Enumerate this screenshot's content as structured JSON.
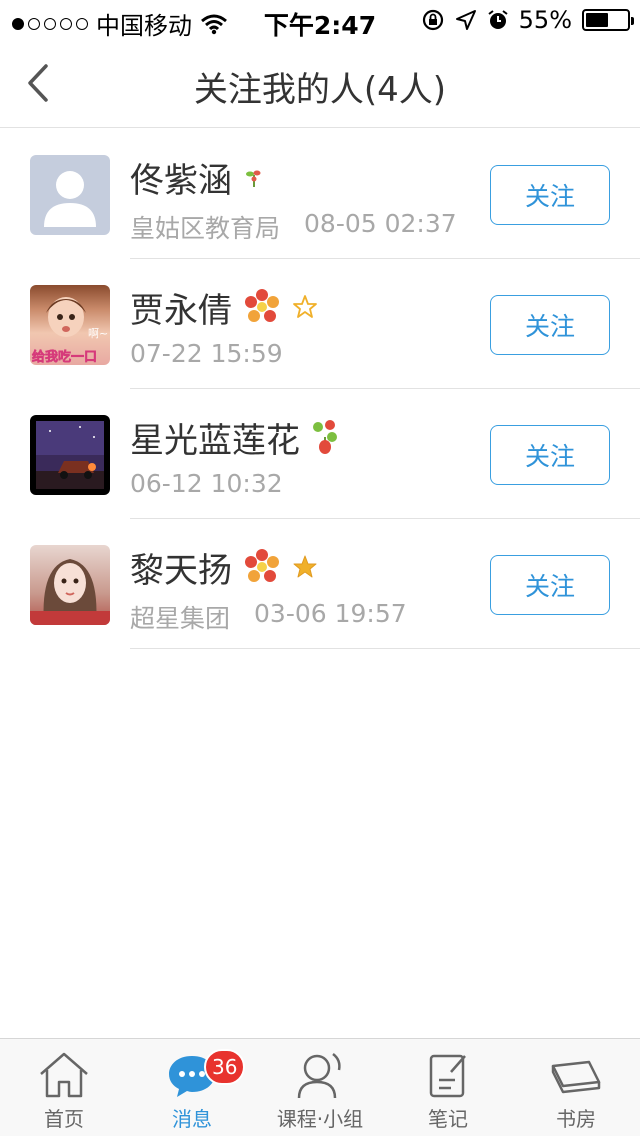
{
  "status_bar": {
    "carrier": "中国移动",
    "time": "下午2:47",
    "battery": "55%",
    "battery_level": 0.55
  },
  "nav": {
    "title": "关注我的人(4人)",
    "back_icon": "chevron-left-icon"
  },
  "followers": [
    {
      "name": "佟紫涵",
      "org": "皇姑区教育局",
      "date": "08-05 02:37",
      "follow_label": "关注"
    },
    {
      "name": "贾永倩",
      "org": "",
      "date": "07-22 15:59",
      "follow_label": "关注"
    },
    {
      "name": "星光蓝莲花",
      "org": "",
      "date": "06-12 10:32",
      "follow_label": "关注"
    },
    {
      "name": "黎天扬",
      "org": "超星集团",
      "date": "03-06 19:57",
      "follow_label": "关注"
    }
  ],
  "avatar_texts": {
    "row1_caption": "给我吃一口",
    "row1_side": "啊~"
  },
  "tabs": [
    {
      "label": "首页",
      "icon": "home-icon"
    },
    {
      "label": "消息",
      "icon": "chat-bubble-icon",
      "badge": "36"
    },
    {
      "label": "课程·小组",
      "icon": "person-icon"
    },
    {
      "label": "笔记",
      "icon": "note-icon"
    },
    {
      "label": "书房",
      "icon": "book-icon"
    }
  ],
  "colors": {
    "accent": "#2f93d9",
    "badge": "#e8332e",
    "divider": "#e2e2e2"
  }
}
